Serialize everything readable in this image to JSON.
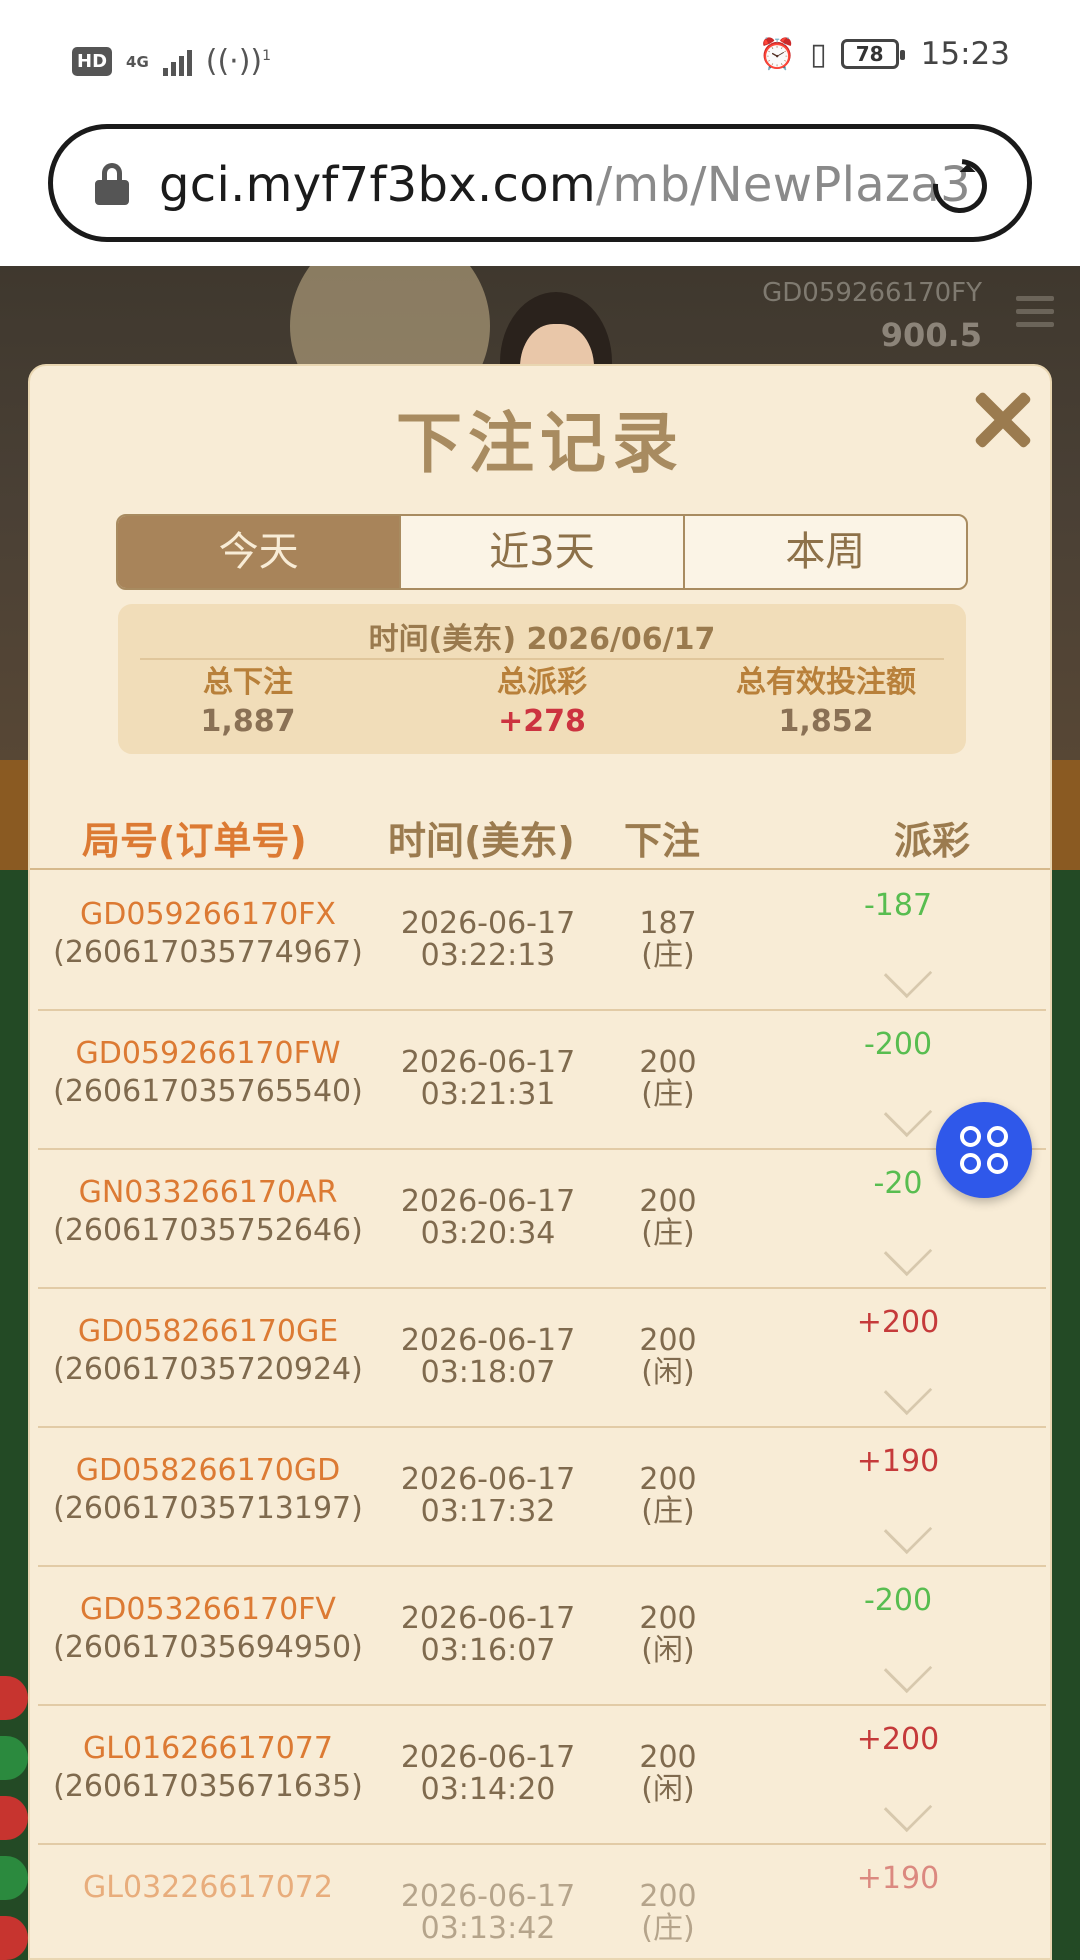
{
  "status_bar": {
    "hd": "HD",
    "network": "4G",
    "hotspot_count": "1",
    "battery": "78",
    "time": "15:23"
  },
  "browser": {
    "url_host": "gci.myf7f3bx.com",
    "url_path": "/mb/NewPlaza3"
  },
  "game": {
    "table_id": "GD059266170FY",
    "balance": "900.5"
  },
  "modal": {
    "title": "下注记录",
    "tabs": [
      {
        "label": "今天",
        "active": true
      },
      {
        "label": "近3天",
        "active": false
      },
      {
        "label": "本周",
        "active": false
      }
    ],
    "summary": {
      "date_label": "时间(美东) 2026/06/17",
      "total_bet_label": "总下注",
      "total_bet": "1,887",
      "total_payout_label": "总派彩",
      "total_payout": "+278",
      "valid_bet_label": "总有效投注额",
      "valid_bet": "1,852"
    },
    "columns": {
      "id": "局号(订单号)",
      "time": "时间(美东)",
      "bet": "下注",
      "payout": "派彩"
    },
    "rows": [
      {
        "round_id": "GD059266170FX",
        "order_id": "(260617035774967)",
        "date": "2026-06-17",
        "time": "03:22:13",
        "bet": "187",
        "side": "(庄)",
        "payout": "-187"
      },
      {
        "round_id": "GD059266170FW",
        "order_id": "(260617035765540)",
        "date": "2026-06-17",
        "time": "03:21:31",
        "bet": "200",
        "side": "(庄)",
        "payout": "-200"
      },
      {
        "round_id": "GN033266170AR",
        "order_id": "(260617035752646)",
        "date": "2026-06-17",
        "time": "03:20:34",
        "bet": "200",
        "side": "(庄)",
        "payout": "-20"
      },
      {
        "round_id": "GD058266170GE",
        "order_id": "(260617035720924)",
        "date": "2026-06-17",
        "time": "03:18:07",
        "bet": "200",
        "side": "(闲)",
        "payout": "+200"
      },
      {
        "round_id": "GD058266170GD",
        "order_id": "(260617035713197)",
        "date": "2026-06-17",
        "time": "03:17:32",
        "bet": "200",
        "side": "(庄)",
        "payout": "+190"
      },
      {
        "round_id": "GD053266170FV",
        "order_id": "(260617035694950)",
        "date": "2026-06-17",
        "time": "03:16:07",
        "bet": "200",
        "side": "(闲)",
        "payout": "-200"
      },
      {
        "round_id": "GL01626617077",
        "order_id": "(260617035671635)",
        "date": "2026-06-17",
        "time": "03:14:20",
        "bet": "200",
        "side": "(闲)",
        "payout": "+200"
      },
      {
        "round_id": "GL03226617072",
        "order_id": "",
        "date": "2026-06-17",
        "time": "03:13:42",
        "bet": "200",
        "side": "(庄)",
        "payout": "+190"
      }
    ]
  },
  "colors": {
    "modal_bg": "#f8ecd6",
    "accent_brown": "#a8845a",
    "id_orange": "#dc7a33",
    "payout_negative": "#58bd50",
    "payout_positive": "#c53a3a",
    "float_button": "#2f58ea"
  }
}
